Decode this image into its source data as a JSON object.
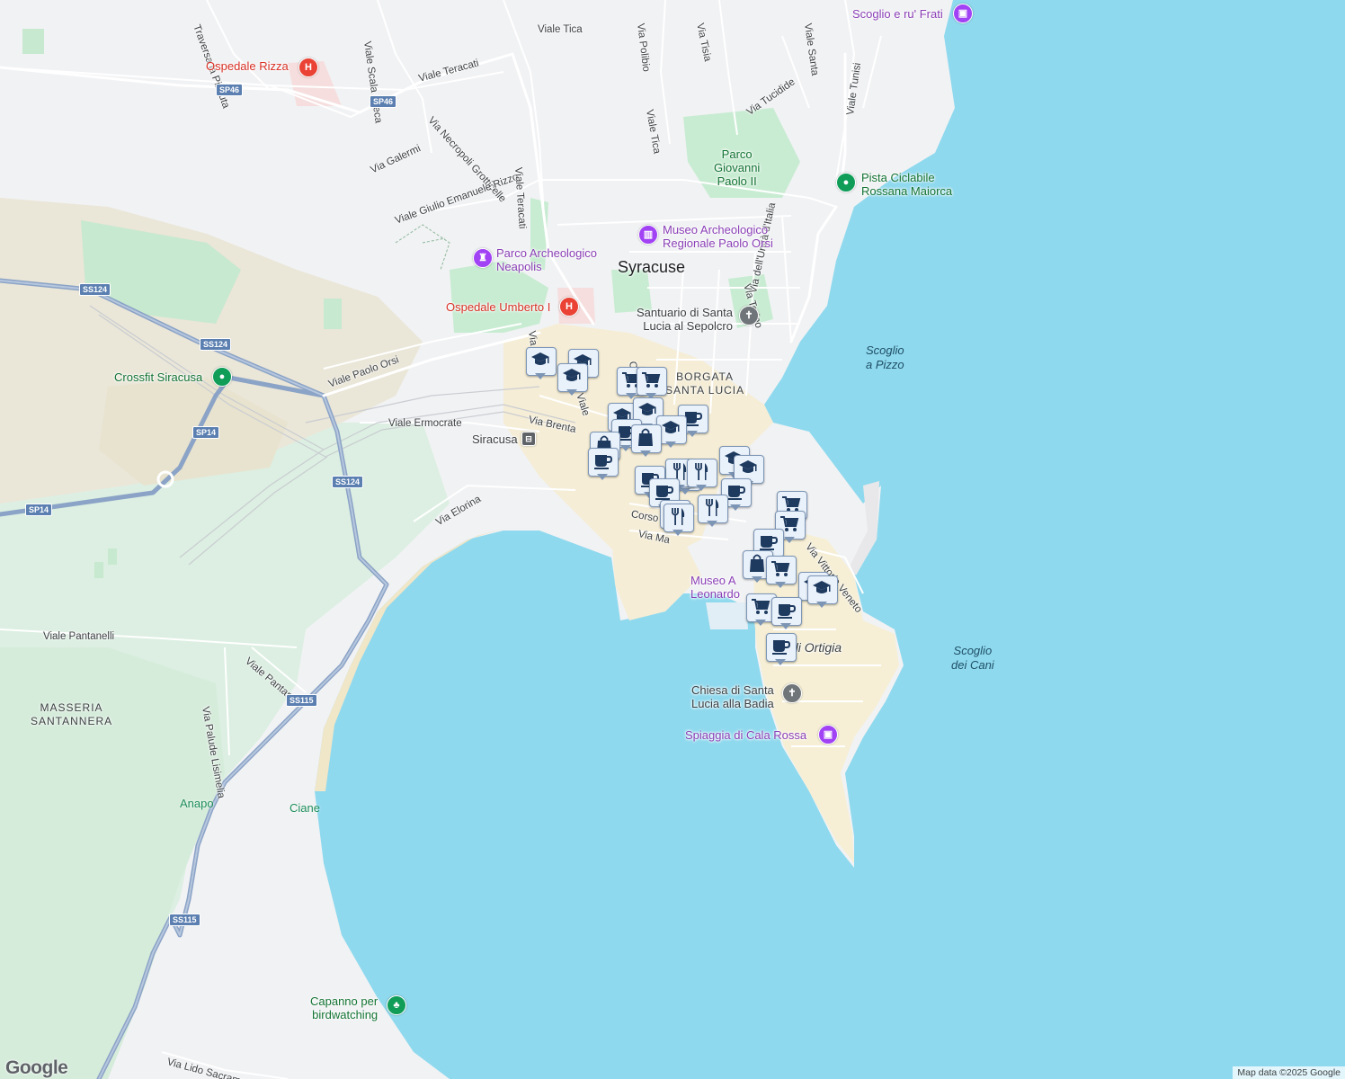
{
  "map": {
    "city": "Syracuse",
    "districts": [
      {
        "name": "borgata",
        "lines": [
          "BORGATA",
          "SANTA LUCIA"
        ]
      },
      {
        "name": "masseria",
        "lines": [
          "MASSERIA",
          "SANTANNERA"
        ]
      }
    ],
    "water_labels": [
      {
        "name": "scoglio-a-pizzo",
        "lines": [
          "Scoglio",
          "a Pizzo"
        ]
      },
      {
        "name": "scoglio-dei-cani",
        "lines": [
          "Scoglio",
          "dei Cani"
        ]
      }
    ],
    "roads": [
      "Traversa la Pizzuta",
      "Viale Scala Greca",
      "Viale Teracati",
      "Viale Tica",
      "Via Polibio",
      "Via Tisia",
      "Viale Santa",
      "Viale Tunisi",
      "Via Tucidide",
      "Via Necropoli Grotticelle",
      "Via Galermi",
      "Viale Giulio Emanuele Rizzo",
      "Viale Teracati",
      "Viale Tica",
      "Via Torino",
      "Via dell'Unità d'Italia",
      "Corso",
      "Viale Paolo Orsi",
      "Viale Ermocrate",
      "Via Brenta",
      "Via Elorina",
      "Corso",
      "Via Ma",
      "Via Vittorio Veneto",
      "Viale Pantanelli",
      "Viale Pantanelli",
      "Via Palude Lisimelia",
      "Via Lido Sacramento",
      "Via",
      "Viale"
    ],
    "shields": [
      "SP46",
      "SP46",
      "SS124",
      "SS124",
      "SP14",
      "SS124",
      "SP14",
      "SS115",
      "SS115"
    ],
    "pois": {
      "ospedale_rizza": "Ospedale Rizza",
      "scoglio_frati": "Scoglio e ru' Frati",
      "pista": [
        "Pista Ciclabile",
        "Rossana Maiorca"
      ],
      "parco_gp": [
        "Parco",
        "Giovanni",
        "Paolo II"
      ],
      "museo_orsi": [
        "Museo Archeologico",
        "Regionale Paolo Orsi"
      ],
      "parco_neapolis": [
        "Parco Archeologico",
        "Neapolis"
      ],
      "ospedale_umberto": "Ospedale Umberto I",
      "santuario": [
        "Santuario di Santa",
        "Lucia al Sepolcro"
      ],
      "crossfit": "Crossfit Siracusa",
      "stazione": "Siracusa",
      "museo_leonardo": [
        "Museo A",
        "Leonardo"
      ],
      "ortigia": "di Ortigia",
      "chiesa": [
        "Chiesa di Santa",
        "Lucia alla Badia"
      ],
      "cala_rossa": "Spiaggia di Cala Rossa",
      "anapo": "Anapo",
      "ciane": "Ciane",
      "capanno": [
        "Capanno per",
        "birdwatching"
      ]
    },
    "hospital_glyph": "H",
    "rail_glyph": "⊟",
    "markers": [
      {
        "type": "school"
      },
      {
        "type": "school"
      },
      {
        "type": "school"
      },
      {
        "type": "cart"
      },
      {
        "type": "cart"
      },
      {
        "type": "school"
      },
      {
        "type": "school"
      },
      {
        "type": "cafe"
      },
      {
        "type": "school"
      },
      {
        "type": "cafe"
      },
      {
        "type": "bag"
      },
      {
        "type": "bag"
      },
      {
        "type": "cafe"
      },
      {
        "type": "cafe"
      },
      {
        "type": "restaurant"
      },
      {
        "type": "restaurant"
      },
      {
        "type": "school"
      },
      {
        "type": "school"
      },
      {
        "type": "cafe"
      },
      {
        "type": "cafe"
      },
      {
        "type": "cafe"
      },
      {
        "type": "cart"
      },
      {
        "type": "restaurant"
      },
      {
        "type": "restaurant"
      },
      {
        "type": "restaurant"
      },
      {
        "type": "cart"
      },
      {
        "type": "cafe"
      },
      {
        "type": "bag"
      },
      {
        "type": "cart"
      },
      {
        "type": "school"
      },
      {
        "type": "school"
      },
      {
        "type": "cart"
      },
      {
        "type": "cafe"
      },
      {
        "type": "cafe"
      }
    ],
    "colors": {
      "sea": "#8fd9ee",
      "land": "#f1f2f4",
      "park": "#c8ecd2",
      "highway": "#8ba3c6",
      "marker_fill": "#e9f1fb",
      "marker_icon": "#1e3a5f"
    }
  },
  "logo": "Google",
  "attribution": "Map data ©2025 Google"
}
